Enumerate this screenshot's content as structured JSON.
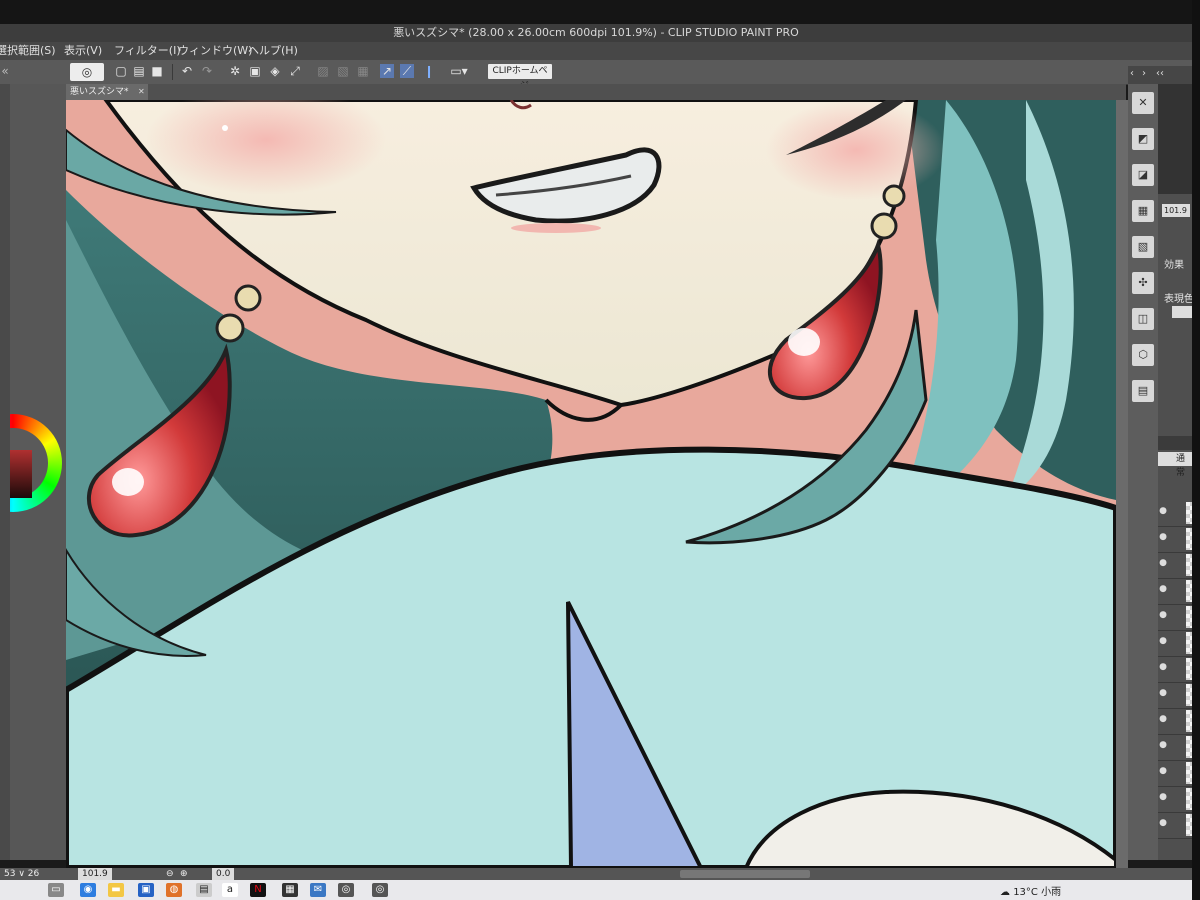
{
  "window": {
    "title": "悪いスズシマ* (28.00 x 26.00cm 600dpi 101.9%)  - CLIP STUDIO PAINT PRO"
  },
  "menu": {
    "items": [
      "選択範囲(S)",
      "表示(V)",
      "フィルター(I)",
      "ウィンドウ(W)",
      "ヘルプ(H)"
    ]
  },
  "toolbar": {
    "clip_home_label": "CLIPホームページ"
  },
  "document_tab": {
    "label": "悪いスズシマ*"
  },
  "right_panel": {
    "zoom_value": "101.9",
    "effect_label": "効果",
    "display_color_label": "表現色",
    "blend_mode_label": "通常"
  },
  "status_bar": {
    "left_readout": "53 ∨ 26",
    "zoom_value": "101.9",
    "rotation_value": "0.0"
  },
  "taskbar": {
    "weather_temp": "13°C",
    "weather_desc": "小雨"
  }
}
